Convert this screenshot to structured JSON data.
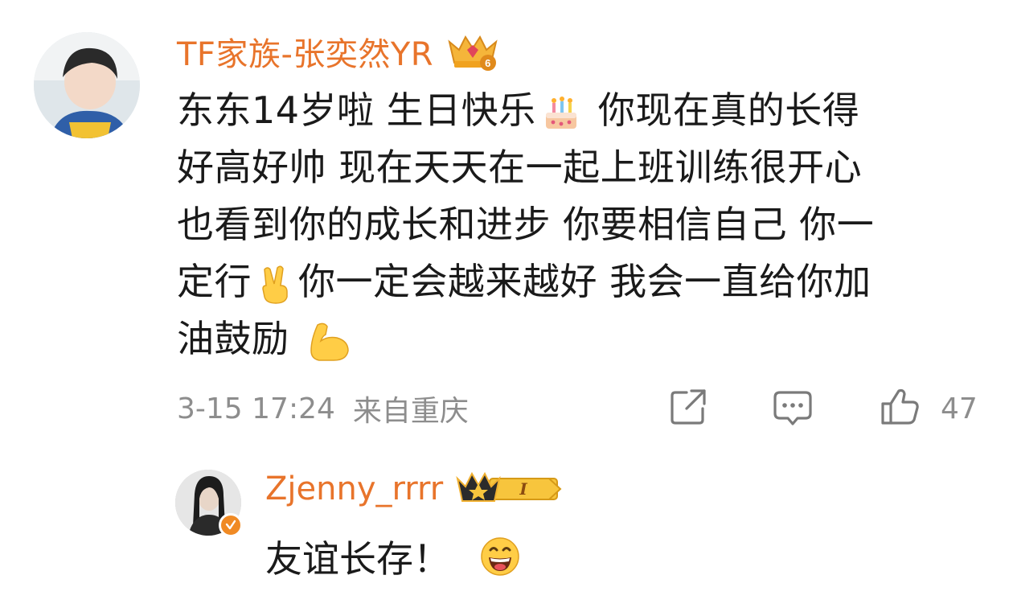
{
  "comment": {
    "username": "TF家族-张奕然YR",
    "lines": [
      [
        "东东14岁啦 生日快乐",
        "cake",
        " 你现在真的长得"
      ],
      [
        "好高好帅 现在天天在一起上班训练很开心"
      ],
      [
        "也看到你的成长和进步 你要相信自己 你一"
      ],
      [
        "定行",
        "victory",
        "你一定会越来越好  我会一直给你加"
      ],
      [
        "油鼓励 ",
        "muscle",
        ""
      ]
    ],
    "text_line1_a": "东东14岁啦 生日快乐",
    "text_line1_b": " 你现在真的长得",
    "text_line2": "好高好帅 现在天天在一起上班训练很开心",
    "text_line3": "也看到你的成长和进步 你要相信自己 你一",
    "text_line4_a": "定行",
    "text_line4_b": "你一定会越来越好  我会一直给你加",
    "text_line5": "油鼓励 ",
    "date": "3-15 17:24",
    "location": "来自重庆",
    "like_count": "47",
    "badge_icon": "crown-level-6-icon"
  },
  "reply": {
    "username": "Zjenny_rrrr",
    "text": "友谊长存！",
    "emoji": "grinning-face-icon",
    "badge_icon": "crown-level-1-icon",
    "badge_level": "I"
  },
  "colors": {
    "username": "#e8742b",
    "meta": "#8d8d8d",
    "text": "#1a1a1a"
  }
}
